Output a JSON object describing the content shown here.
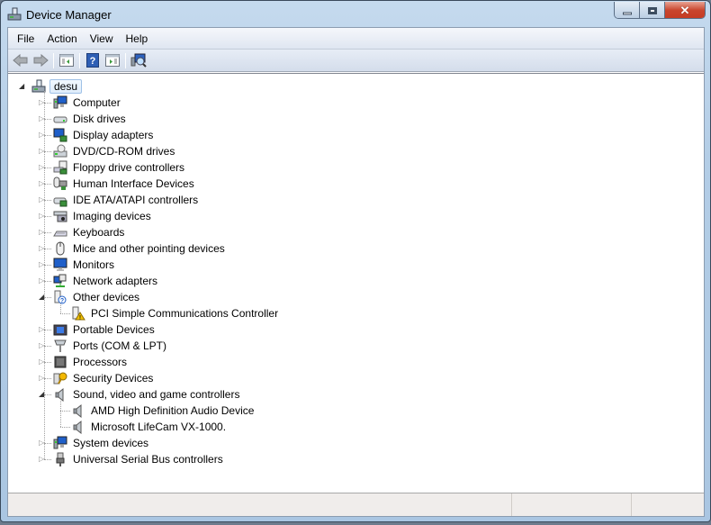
{
  "window": {
    "title": "Device Manager",
    "caption_buttons": {
      "minimize": "minimize",
      "maximize": "maximize",
      "close": "close"
    }
  },
  "menubar": {
    "items": [
      {
        "label": "File"
      },
      {
        "label": "Action"
      },
      {
        "label": "View"
      },
      {
        "label": "Help"
      }
    ]
  },
  "toolbar": {
    "buttons": [
      {
        "name": "back",
        "icon": "arrow-left-icon"
      },
      {
        "name": "forward",
        "icon": "arrow-right-icon"
      },
      {
        "name": "show-hide-console-tree",
        "icon": "console-tree-icon"
      },
      {
        "name": "help",
        "icon": "help-icon"
      },
      {
        "name": "show-hide-action-pane",
        "icon": "action-pane-icon"
      },
      {
        "name": "scan-hardware-changes",
        "icon": "scan-hardware-icon"
      }
    ]
  },
  "tree": {
    "root": {
      "label": "desu",
      "expanded": true,
      "selected": true
    },
    "categories": [
      {
        "label": "Computer",
        "icon": "computer-icon",
        "expanded": false
      },
      {
        "label": "Disk drives",
        "icon": "disk-drive-icon",
        "expanded": false
      },
      {
        "label": "Display adapters",
        "icon": "display-adapter-icon",
        "expanded": false
      },
      {
        "label": "DVD/CD-ROM drives",
        "icon": "dvd-drive-icon",
        "expanded": false
      },
      {
        "label": "Floppy drive controllers",
        "icon": "floppy-controller-icon",
        "expanded": false
      },
      {
        "label": "Human Interface Devices",
        "icon": "hid-icon",
        "expanded": false
      },
      {
        "label": "IDE ATA/ATAPI controllers",
        "icon": "ide-controller-icon",
        "expanded": false
      },
      {
        "label": "Imaging devices",
        "icon": "imaging-device-icon",
        "expanded": false
      },
      {
        "label": "Keyboards",
        "icon": "keyboard-icon",
        "expanded": false
      },
      {
        "label": "Mice and other pointing devices",
        "icon": "mouse-icon",
        "expanded": false
      },
      {
        "label": "Monitors",
        "icon": "monitor-icon",
        "expanded": false
      },
      {
        "label": "Network adapters",
        "icon": "network-adapter-icon",
        "expanded": false
      },
      {
        "label": "Other devices",
        "icon": "unknown-device-icon",
        "expanded": true,
        "children": [
          {
            "label": "PCI Simple Communications Controller",
            "icon": "warning-device-icon"
          }
        ]
      },
      {
        "label": "Portable Devices",
        "icon": "portable-device-icon",
        "expanded": false
      },
      {
        "label": "Ports (COM & LPT)",
        "icon": "port-icon",
        "expanded": false
      },
      {
        "label": "Processors",
        "icon": "processor-icon",
        "expanded": false
      },
      {
        "label": "Security Devices",
        "icon": "security-device-icon",
        "expanded": false
      },
      {
        "label": "Sound, video and game controllers",
        "icon": "speaker-icon",
        "expanded": true,
        "children": [
          {
            "label": "AMD High Definition Audio Device",
            "icon": "speaker-icon"
          },
          {
            "label": "Microsoft LifeCam VX-1000.",
            "icon": "speaker-icon"
          }
        ]
      },
      {
        "label": "System devices",
        "icon": "system-device-icon",
        "expanded": false
      },
      {
        "label": "Universal Serial Bus controllers",
        "icon": "usb-icon",
        "expanded": false
      }
    ]
  },
  "statusbar": {
    "panes": [
      "",
      "",
      ""
    ]
  }
}
